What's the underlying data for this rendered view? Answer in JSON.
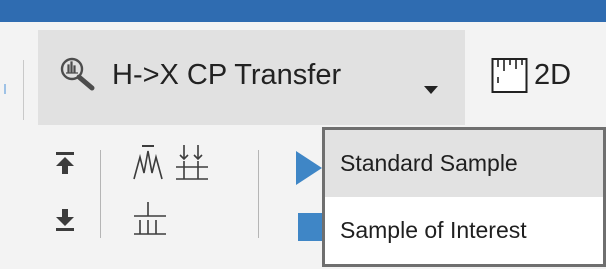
{
  "toolbar": {
    "experiment_selector": {
      "label": "H->X CP Transfer",
      "icon": "magnify-spectrum-icon",
      "dropdown_icon": "caret-down-icon"
    },
    "twod_button": {
      "label": "2D",
      "icon": "2d-experiment-icon"
    },
    "tools": [
      {
        "name": "move-to-top",
        "icon": "arrow-up-to-bar-icon"
      },
      {
        "name": "move-to-bottom",
        "icon": "arrow-down-to-bar-icon"
      },
      {
        "name": "peak-pick",
        "icon": "peak-icon"
      },
      {
        "name": "integrate-down",
        "icon": "multi-arrow-down-icon"
      },
      {
        "name": "baseline",
        "icon": "baseline-bars-icon"
      },
      {
        "name": "run",
        "icon": "play-icon"
      },
      {
        "name": "stop",
        "icon": "stop-square-icon"
      }
    ]
  },
  "dropdown": {
    "items": [
      {
        "label": "Standard Sample",
        "highlighted": true
      },
      {
        "label": "Sample of Interest",
        "highlighted": false
      }
    ]
  },
  "colors": {
    "title_bar": "#2f6cb1",
    "toolbar_bg": "#f3f3f3",
    "selector_bg": "#e1e1e1",
    "menu_border": "#6f6f6f",
    "menu_highlight": "#e2e2e2",
    "accent_blue": "#3f86c6"
  }
}
